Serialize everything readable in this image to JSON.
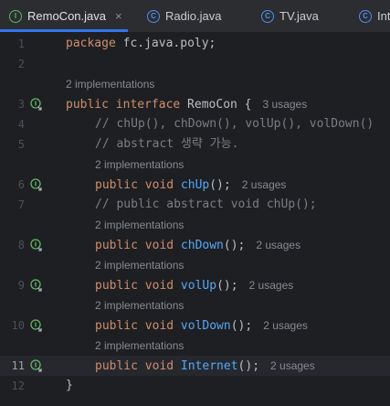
{
  "tabs": [
    {
      "label": "RemoCon.java",
      "icon": "interface-icon",
      "icon_letter": "I",
      "active": true,
      "close": "×"
    },
    {
      "label": "Radio.java",
      "icon": "class-icon",
      "icon_letter": "C",
      "active": false
    },
    {
      "label": "TV.java",
      "icon": "class-icon",
      "icon_letter": "C",
      "active": false
    },
    {
      "label": "Int",
      "icon": "class-icon",
      "icon_letter": "C",
      "active": false
    }
  ],
  "editor": {
    "line_numbers": [
      "1",
      "2",
      "3",
      "4",
      "5",
      "6",
      "7",
      "8",
      "9",
      "10",
      "11",
      "12"
    ],
    "current_line": "11",
    "hints": {
      "impl_interface": "2 implementations",
      "impl_chUp": "2 implementations",
      "impl_comment": "2 implementations",
      "impl_chDown": "2 implementations",
      "impl_volUp": "2 implementations",
      "impl_volDown": "2 implementations",
      "impl_internet": "2 implementations"
    },
    "code": {
      "l1_kw": "package",
      "l1_rest": " fc.java.poly;",
      "l3_kw": "public interface",
      "l3_rest": " RemoCon {",
      "l3_usages": "3 usages",
      "l4_comment": "// chUp(), chDown(), volUp(), volDown()",
      "l5_comment": "// abstract 생략 가능.",
      "l6_kw": "public void",
      "l6_fn": "chUp",
      "l6_rest": "();",
      "l6_usages": "2 usages",
      "l7_comment": "// public abstract void chUp();",
      "l8_kw": "public void",
      "l8_fn": "chDown",
      "l8_rest": "();",
      "l8_usages": "2 usages",
      "l9_kw": "public void",
      "l9_fn": "volUp",
      "l9_rest": "();",
      "l9_usages": "2 usages",
      "l10_kw": "public void",
      "l10_fn": "volDown",
      "l10_rest": "();",
      "l10_usages": "2 usages",
      "l11_kw": "public void",
      "l11_fn": "Internet",
      "l11_rest": "();",
      "l11_usages": "2 usages",
      "l12_rest": "}"
    }
  },
  "colors": {
    "accent": "#3574f0",
    "keyword": "#cf8e6d",
    "function": "#56a8f5",
    "comment": "#7a7e85",
    "gutter_icon": "#5fb865"
  }
}
